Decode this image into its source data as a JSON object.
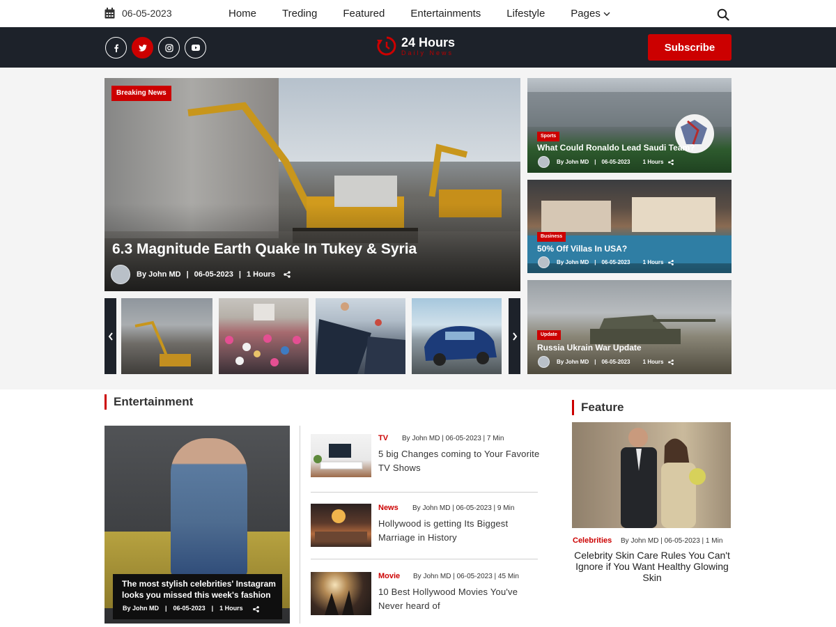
{
  "topbar": {
    "date": "06-05-2023",
    "nav": [
      "Home",
      "Treding",
      "Featured",
      "Entertainments",
      "Lifestyle",
      "Pages"
    ]
  },
  "brand": {
    "title": "24 Hours",
    "subtitle": "Daily News",
    "subscribe_label": "Subscribe",
    "social": [
      "facebook-icon",
      "twitter-icon",
      "instagram-icon",
      "youtube-icon"
    ],
    "active_social": "twitter-icon",
    "accent_color": "#cc0000",
    "dark_color": "#1d222a"
  },
  "hero": {
    "badge": "Breaking News",
    "title": "6.3 Magnitude Earth Quake In Tukey & Syria",
    "author": "By John MD",
    "date": "06-05-2023",
    "time": "1 Hours"
  },
  "side": [
    {
      "badge": "Sports",
      "title": "What Could Ronaldo Lead Saudi Team?",
      "author": "By John MD",
      "date": "06-05-2023",
      "time": "1 Hours"
    },
    {
      "badge": "Business",
      "title": "50% Off Villas In USA?",
      "author": "By John MD",
      "date": "06-05-2023",
      "time": "1 Hours"
    },
    {
      "badge": "Update",
      "title": "Russia Ukrain War Update",
      "author": "By John MD",
      "date": "06-05-2023",
      "time": "1 Hours"
    }
  ],
  "entertainment": {
    "heading": "Entertainment",
    "main": {
      "title": "The most stylish celebrities' Instagram looks you missed this week's fashion",
      "author": "By John MD",
      "date": "06-05-2023",
      "time": "1 Hours"
    },
    "items": [
      {
        "cat": "TV",
        "meta": "By John MD | 06-05-2023 | 7 Min",
        "title": "5 big Changes coming to Your Favorite TV Shows"
      },
      {
        "cat": "News",
        "meta": "By John MD | 06-05-2023 | 9 Min",
        "title": "Hollywood is getting Its Biggest Marriage in History"
      },
      {
        "cat": "Movie",
        "meta": "By John MD | 06-05-2023 | 45 Min",
        "title": "10 Best Hollywood Movies You've Never heard of"
      }
    ]
  },
  "feature": {
    "heading": "Feature",
    "cat": "Celebrities",
    "meta": "By John MD | 06-05-2023 | 1 Min",
    "title": "Celebrity Skin Care Rules You Can't Ignore if You Want Healthy Glowing Skin"
  }
}
